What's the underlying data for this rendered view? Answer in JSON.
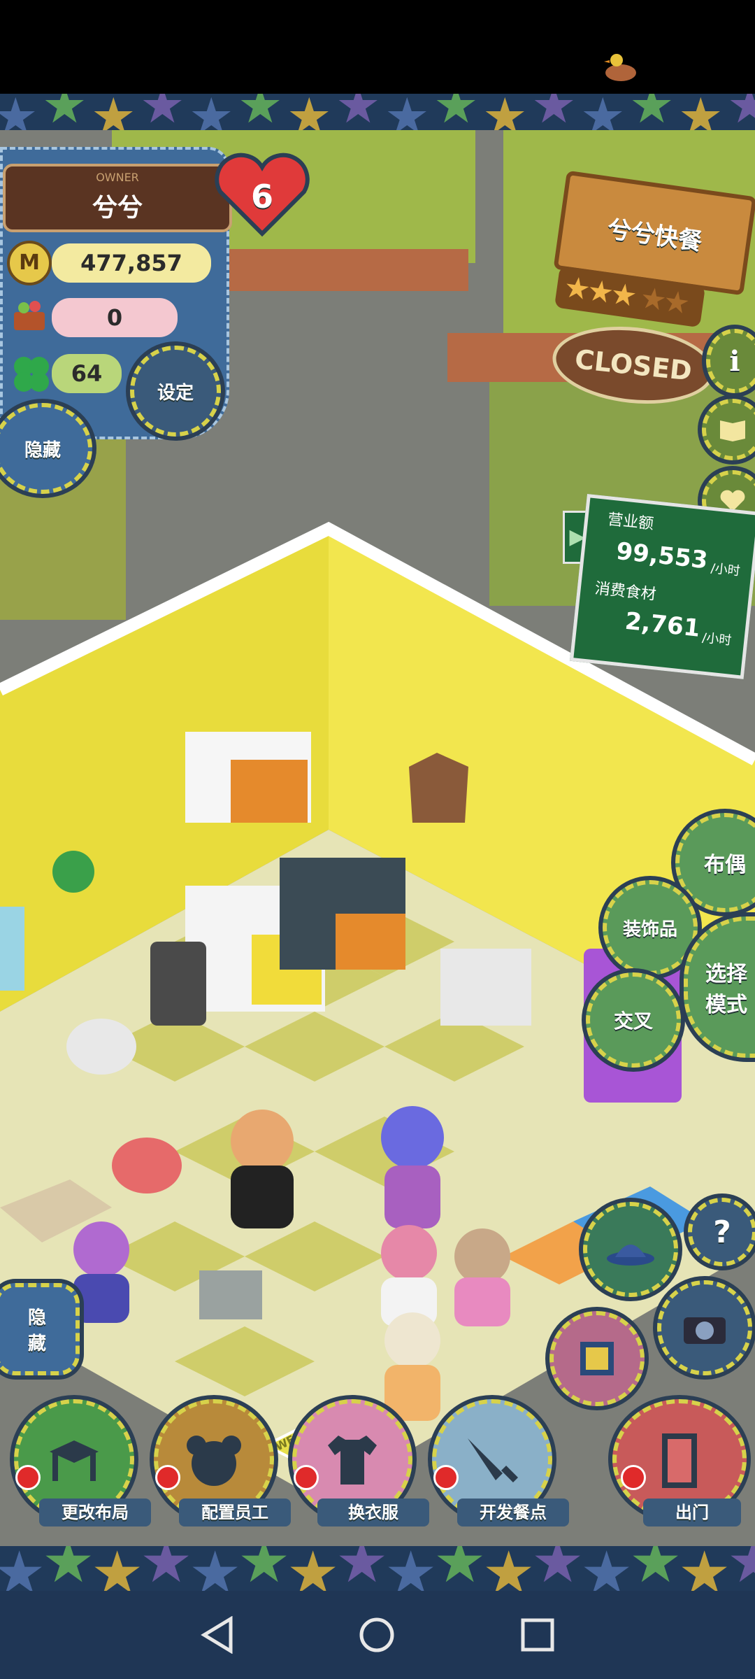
{
  "owner": {
    "caption": "OWNER",
    "name": "兮兮"
  },
  "level": "6",
  "stats": {
    "money": "477,857",
    "ingredients": "0",
    "clovers": "64"
  },
  "buttons": {
    "settings": "设定",
    "hide_top": "隐藏",
    "hide_bottom": "隐藏",
    "help": "?"
  },
  "store": {
    "name": "兮兮快餐",
    "status": "CLOSED",
    "stars_filled": 3,
    "stars_total": 5
  },
  "revenue": {
    "revenue_label": "营业额",
    "revenue_value": "99,553",
    "revenue_unit": "/小时",
    "consume_label": "消费食材",
    "consume_value": "2,761",
    "consume_unit": "/小时"
  },
  "right_menu": {
    "doll": "布偶",
    "decor": "装饰品",
    "cross": "交叉",
    "select_mode": "选择模式"
  },
  "scene": {
    "welcome_mat": "WELCOME"
  },
  "bottom_menu": [
    {
      "label": "更改布局"
    },
    {
      "label": "配置员工"
    },
    {
      "label": "换衣服"
    },
    {
      "label": "开发餐点"
    },
    {
      "label": "出门"
    }
  ],
  "colors": {
    "scene_wall": "#efe44a",
    "floor_light": "#f4f1d9",
    "floor_dark": "#d8d67a",
    "board_green": "#1f6b3b"
  },
  "icons": [
    "duck-status-icon",
    "coin-icon",
    "basket-icon",
    "clover-icon",
    "info-icon",
    "book-icon",
    "heart-icon",
    "hat-icon",
    "camera-icon",
    "picture-icon",
    "table-icon",
    "bear-icon",
    "shirt-icon",
    "knife-icon",
    "door-icon"
  ]
}
